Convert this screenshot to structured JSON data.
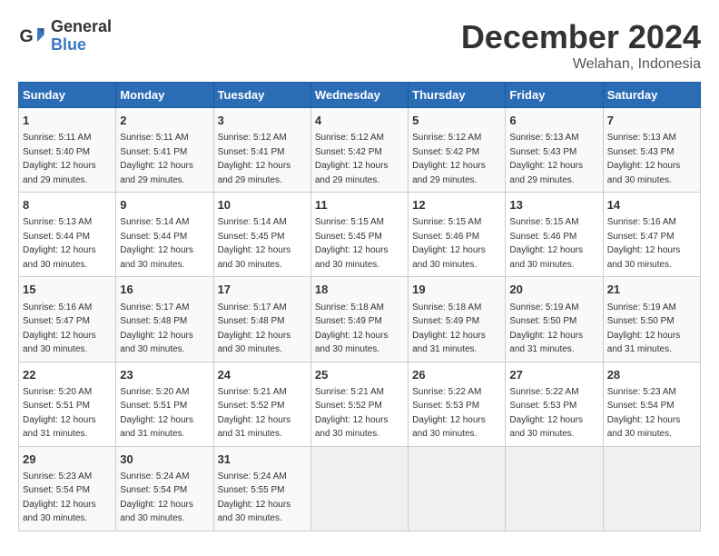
{
  "header": {
    "logo_general": "General",
    "logo_blue": "Blue",
    "month_title": "December 2024",
    "location": "Welahan, Indonesia"
  },
  "days_of_week": [
    "Sunday",
    "Monday",
    "Tuesday",
    "Wednesday",
    "Thursday",
    "Friday",
    "Saturday"
  ],
  "weeks": [
    [
      {
        "day": "1",
        "sunrise": "5:11 AM",
        "sunset": "5:40 PM",
        "daylight": "12 hours and 29 minutes."
      },
      {
        "day": "2",
        "sunrise": "5:11 AM",
        "sunset": "5:41 PM",
        "daylight": "12 hours and 29 minutes."
      },
      {
        "day": "3",
        "sunrise": "5:12 AM",
        "sunset": "5:41 PM",
        "daylight": "12 hours and 29 minutes."
      },
      {
        "day": "4",
        "sunrise": "5:12 AM",
        "sunset": "5:42 PM",
        "daylight": "12 hours and 29 minutes."
      },
      {
        "day": "5",
        "sunrise": "5:12 AM",
        "sunset": "5:42 PM",
        "daylight": "12 hours and 29 minutes."
      },
      {
        "day": "6",
        "sunrise": "5:13 AM",
        "sunset": "5:43 PM",
        "daylight": "12 hours and 29 minutes."
      },
      {
        "day": "7",
        "sunrise": "5:13 AM",
        "sunset": "5:43 PM",
        "daylight": "12 hours and 30 minutes."
      }
    ],
    [
      {
        "day": "8",
        "sunrise": "5:13 AM",
        "sunset": "5:44 PM",
        "daylight": "12 hours and 30 minutes."
      },
      {
        "day": "9",
        "sunrise": "5:14 AM",
        "sunset": "5:44 PM",
        "daylight": "12 hours and 30 minutes."
      },
      {
        "day": "10",
        "sunrise": "5:14 AM",
        "sunset": "5:45 PM",
        "daylight": "12 hours and 30 minutes."
      },
      {
        "day": "11",
        "sunrise": "5:15 AM",
        "sunset": "5:45 PM",
        "daylight": "12 hours and 30 minutes."
      },
      {
        "day": "12",
        "sunrise": "5:15 AM",
        "sunset": "5:46 PM",
        "daylight": "12 hours and 30 minutes."
      },
      {
        "day": "13",
        "sunrise": "5:15 AM",
        "sunset": "5:46 PM",
        "daylight": "12 hours and 30 minutes."
      },
      {
        "day": "14",
        "sunrise": "5:16 AM",
        "sunset": "5:47 PM",
        "daylight": "12 hours and 30 minutes."
      }
    ],
    [
      {
        "day": "15",
        "sunrise": "5:16 AM",
        "sunset": "5:47 PM",
        "daylight": "12 hours and 30 minutes."
      },
      {
        "day": "16",
        "sunrise": "5:17 AM",
        "sunset": "5:48 PM",
        "daylight": "12 hours and 30 minutes."
      },
      {
        "day": "17",
        "sunrise": "5:17 AM",
        "sunset": "5:48 PM",
        "daylight": "12 hours and 30 minutes."
      },
      {
        "day": "18",
        "sunrise": "5:18 AM",
        "sunset": "5:49 PM",
        "daylight": "12 hours and 30 minutes."
      },
      {
        "day": "19",
        "sunrise": "5:18 AM",
        "sunset": "5:49 PM",
        "daylight": "12 hours and 31 minutes."
      },
      {
        "day": "20",
        "sunrise": "5:19 AM",
        "sunset": "5:50 PM",
        "daylight": "12 hours and 31 minutes."
      },
      {
        "day": "21",
        "sunrise": "5:19 AM",
        "sunset": "5:50 PM",
        "daylight": "12 hours and 31 minutes."
      }
    ],
    [
      {
        "day": "22",
        "sunrise": "5:20 AM",
        "sunset": "5:51 PM",
        "daylight": "12 hours and 31 minutes."
      },
      {
        "day": "23",
        "sunrise": "5:20 AM",
        "sunset": "5:51 PM",
        "daylight": "12 hours and 31 minutes."
      },
      {
        "day": "24",
        "sunrise": "5:21 AM",
        "sunset": "5:52 PM",
        "daylight": "12 hours and 31 minutes."
      },
      {
        "day": "25",
        "sunrise": "5:21 AM",
        "sunset": "5:52 PM",
        "daylight": "12 hours and 30 minutes."
      },
      {
        "day": "26",
        "sunrise": "5:22 AM",
        "sunset": "5:53 PM",
        "daylight": "12 hours and 30 minutes."
      },
      {
        "day": "27",
        "sunrise": "5:22 AM",
        "sunset": "5:53 PM",
        "daylight": "12 hours and 30 minutes."
      },
      {
        "day": "28",
        "sunrise": "5:23 AM",
        "sunset": "5:54 PM",
        "daylight": "12 hours and 30 minutes."
      }
    ],
    [
      {
        "day": "29",
        "sunrise": "5:23 AM",
        "sunset": "5:54 PM",
        "daylight": "12 hours and 30 minutes."
      },
      {
        "day": "30",
        "sunrise": "5:24 AM",
        "sunset": "5:54 PM",
        "daylight": "12 hours and 30 minutes."
      },
      {
        "day": "31",
        "sunrise": "5:24 AM",
        "sunset": "5:55 PM",
        "daylight": "12 hours and 30 minutes."
      },
      null,
      null,
      null,
      null
    ]
  ],
  "labels": {
    "sunrise": "Sunrise:",
    "sunset": "Sunset:",
    "daylight": "Daylight:"
  }
}
